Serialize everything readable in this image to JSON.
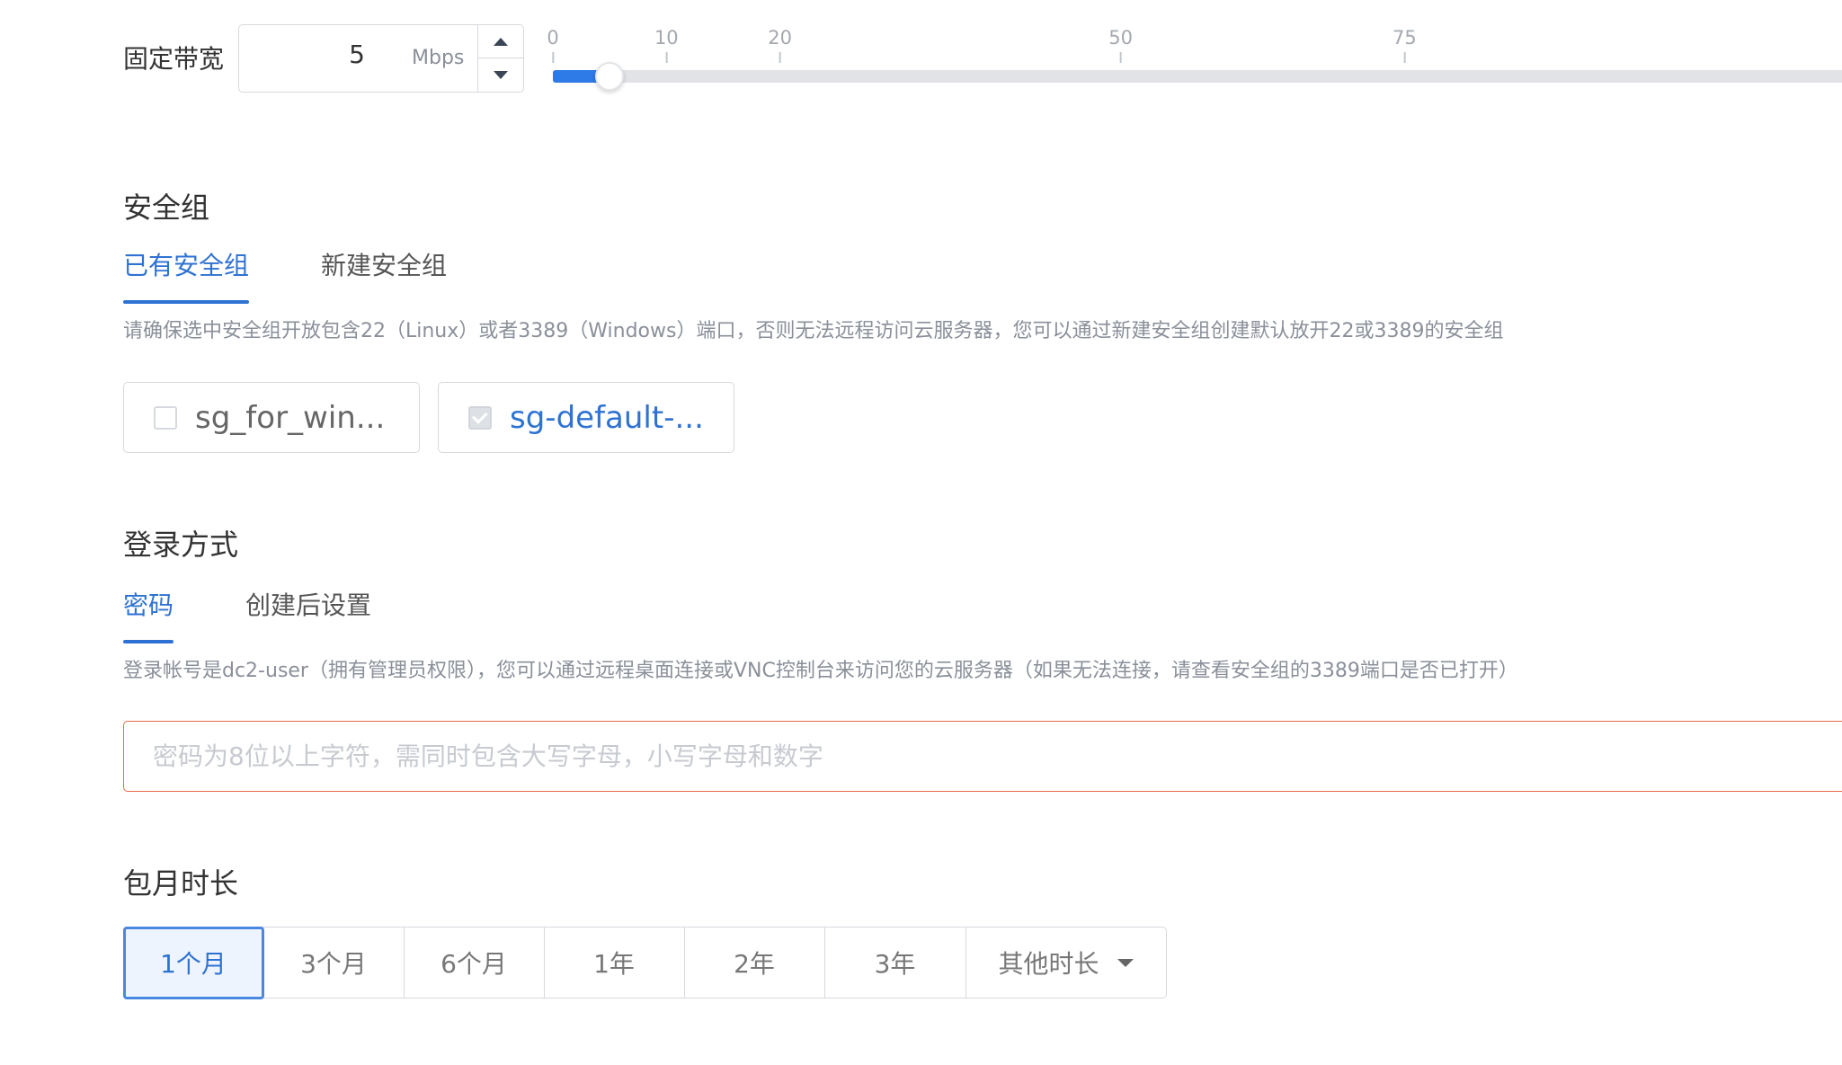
{
  "bandwidth": {
    "label": "固定带宽",
    "value": "5",
    "unit": "Mbps",
    "slider": {
      "value": 5,
      "min": 0,
      "max": 114,
      "ticks": [
        "0",
        "10",
        "20",
        "50",
        "75"
      ],
      "fill_color": "#2e7ae6"
    }
  },
  "security_group": {
    "title": "安全组",
    "tabs": [
      {
        "label": "已有安全组",
        "active": true
      },
      {
        "label": "新建安全组",
        "active": false
      }
    ],
    "hint": "请确保选中安全组开放包含22（Linux）或者3389（Windows）端口，否则无法远程访问云服务器，您可以通过新建安全组创建默认放开22或3389的安全组",
    "options": [
      {
        "name": "sg_for_win...",
        "checked": false
      },
      {
        "name": "sg-default-...",
        "checked": true
      }
    ]
  },
  "login": {
    "title": "登录方式",
    "tabs": [
      {
        "label": "密码",
        "active": true
      },
      {
        "label": "创建后设置",
        "active": false
      }
    ],
    "hint": "登录帐号是dc2-user（拥有管理员权限），您可以通过远程桌面连接或VNC控制台来访问您的云服务器（如果无法连接，请查看安全组的3389端口是否已打开）",
    "password_placeholder": "密码为8位以上字符，需同时包含大写字母，小写字母和数字",
    "password_value": ""
  },
  "duration": {
    "title": "包月时长",
    "options": [
      {
        "label": "1个月",
        "active": true
      },
      {
        "label": "3个月",
        "active": false
      },
      {
        "label": "6个月",
        "active": false
      },
      {
        "label": "1年",
        "active": false
      },
      {
        "label": "2年",
        "active": false
      },
      {
        "label": "3年",
        "active": false
      }
    ],
    "other_label": "其他时长"
  },
  "colors": {
    "accent": "#2e72d2",
    "error_border": "#e66a4c",
    "border": "#d6d9de"
  }
}
